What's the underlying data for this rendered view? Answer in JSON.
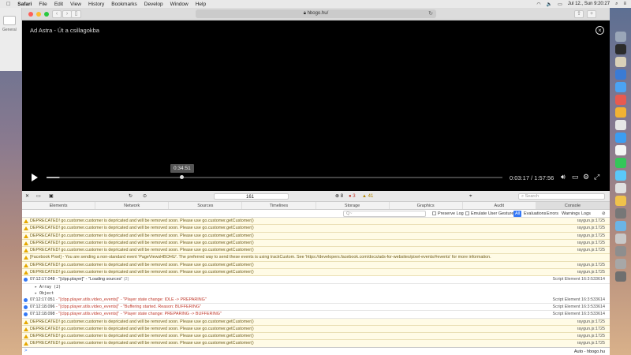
{
  "menubar": {
    "apple": "",
    "items": [
      "Safari",
      "File",
      "Edit",
      "View",
      "History",
      "Bookmarks",
      "Develop",
      "Window",
      "Help"
    ],
    "clock": "Jul 12., Sun 9:20:27"
  },
  "browser": {
    "url": "hbogo.hu/",
    "sidebar_label": "General"
  },
  "player": {
    "title": "Ad Astra - Út a csillagokba",
    "hover_time": "0:34:51",
    "timecode": "0:03:17 / 1:57:56",
    "progress_played": 0.028,
    "progress_buffered": 0.03,
    "hover_position": 0.295
  },
  "devtools": {
    "toolbar": {
      "count": "161",
      "errors": "8",
      "warnings": "3",
      "logs": "41",
      "search_placeholder": "Search"
    },
    "tabs": [
      "Elements",
      "Network",
      "Sources",
      "Timelines",
      "Storage",
      "Graphics",
      "Audit",
      "Console"
    ],
    "active_tab": "Console",
    "filter": {
      "placeholder": "Q~",
      "preserve_log": "Preserve Log",
      "emulate": "Emulate User Gesture",
      "levels": [
        "All",
        "Evaluations",
        "Errors",
        "Warnings",
        "Logs"
      ]
    },
    "rows": [
      {
        "type": "warn",
        "text": "DEPRECATED! go.customer.customer is depricated and will be removed soon. Please use go.customer.getCustomer()",
        "src": "raygun.js:1725"
      },
      {
        "type": "warn",
        "text": "DEPRECATED! go.customer.customer is depricated and will be removed soon. Please use go.customer.getCustomer()",
        "src": "raygun.js:1725"
      },
      {
        "type": "warn",
        "text": "DEPRECATED! go.customer.customer is depricated and will be removed soon. Please use go.customer.getCustomer()",
        "src": "raygun.js:1725"
      },
      {
        "type": "warn",
        "text": "DEPRECATED! go.customer.customer is depricated and will be removed soon. Please use go.customer.getCustomer()",
        "src": "raygun.js:1725"
      },
      {
        "type": "warn",
        "text": "DEPRECATED! go.customer.customer is depricated and will be removed soon. Please use go.customer.getCustomer()",
        "src": "raygun.js:1725"
      },
      {
        "type": "warn",
        "text": "[Facebook Pixel] - You are sending a non-standard event 'PageViewsHBOHU'. The preferred way to send these events is using trackCustom. See 'https://developers.facebook.com/docs/ads-for-websites/pixel-events/#events' for more information.",
        "src": ""
      },
      {
        "type": "warn",
        "text": "DEPRECATED! go.customer.customer is depricated and will be removed soon. Please use go.customer.getCustomer()",
        "src": "raygun.js:1725"
      },
      {
        "type": "warn",
        "text": "DEPRECATED! go.customer.customer is depricated and will be removed soon. Please use go.customer.getCustomer()",
        "src": "raygun.js:1725"
      },
      {
        "type": "info",
        "time": "07:12:17.048",
        "text": "- \"[clpp.player]\" - \"Loading sources\"",
        "extra": "(2)",
        "src": "Script Element 16:3:533614"
      },
      {
        "type": "sub",
        "text": "▸ Array (2)"
      },
      {
        "type": "sub",
        "text": "▸ Object"
      },
      {
        "type": "info",
        "time": "07:12:17.051",
        "text": "- \"[clpp.player.utils.video_events]\" - \"Player state change: IDLE -> PREPARING\"",
        "src": "Script Element 16:3:533614"
      },
      {
        "type": "info",
        "time": "07:12:18.096",
        "text": "- \"[clpp.player.utils.video_events]\" - \"Buffering started. Reason: BUFFERING\"",
        "src": "Script Element 16:3:533614"
      },
      {
        "type": "info",
        "time": "07:12:18.098",
        "text": "- \"[clpp.player.utils.video_events]\" - \"Player state change: PREPARING -> BUFFERING\"",
        "src": "Script Element 16:3:533614"
      },
      {
        "type": "warn",
        "text": "DEPRECATED! go.customer.customer is depricated and will be removed soon. Please use go.customer.getCustomer()",
        "src": "raygun.js:1725"
      },
      {
        "type": "warn",
        "text": "DEPRECATED! go.customer.customer is depricated and will be removed soon. Please use go.customer.getCustomer()",
        "src": "raygun.js:1725"
      },
      {
        "type": "warn",
        "text": "DEPRECATED! go.customer.customer is depricated and will be removed soon. Please use go.customer.getCustomer()",
        "src": "raygun.js:1725"
      },
      {
        "type": "warn",
        "text": "DEPRECATED! go.customer.customer is depricated and will be removed soon. Please use go.customer.getCustomer()",
        "src": "raygun.js:1725"
      }
    ],
    "prompt": {
      "caret": ">",
      "context": "Auto - hbogo.hu"
    }
  },
  "colors": {
    "accent": "#3478f6",
    "warning_bg": "#fffbe6",
    "error_text": "#c0392b"
  }
}
